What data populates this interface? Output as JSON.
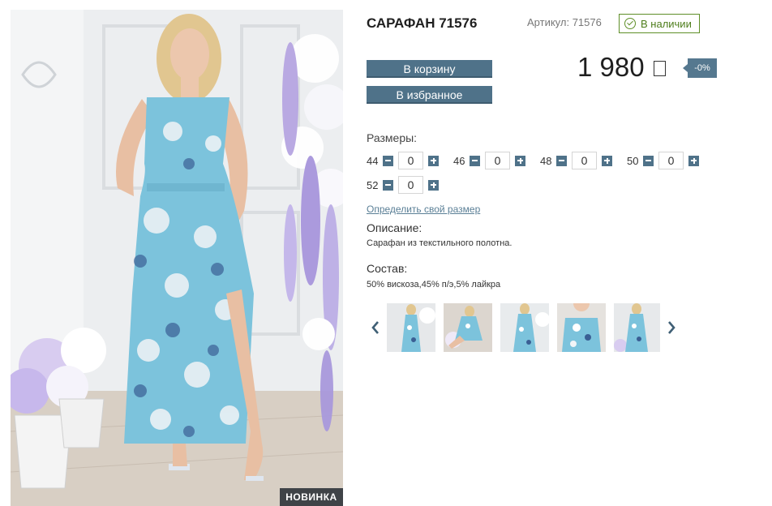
{
  "product": {
    "title": "САРАФАН 71576",
    "sku_label": "Артикул: 71576",
    "stock_status": "В наличии",
    "badge_new": "НОВИНКА",
    "price": "1 980",
    "discount": "-0%"
  },
  "buttons": {
    "cart": "В корзину",
    "favorite": "В избранное"
  },
  "sizes": {
    "label": "Размеры:",
    "items": [
      {
        "size": "44",
        "qty": "0"
      },
      {
        "size": "46",
        "qty": "0"
      },
      {
        "size": "48",
        "qty": "0"
      },
      {
        "size": "50",
        "qty": "0"
      },
      {
        "size": "52",
        "qty": "0"
      }
    ],
    "find_size_link": "Определить свой размер"
  },
  "description": {
    "title": "Описание:",
    "text": "Сарафан из текстильного полотна."
  },
  "composition": {
    "title": "Состав:",
    "text": "50% вискоза,45% п/э,5% лайкра"
  },
  "gallery": {
    "prev_icon": "chevron-left-icon",
    "next_icon": "chevron-right-icon",
    "thumbnail_count": 5
  },
  "colors": {
    "button": "#4f7289",
    "stock_green": "#5f8f28",
    "dress_blue": "#7cc3dc"
  }
}
